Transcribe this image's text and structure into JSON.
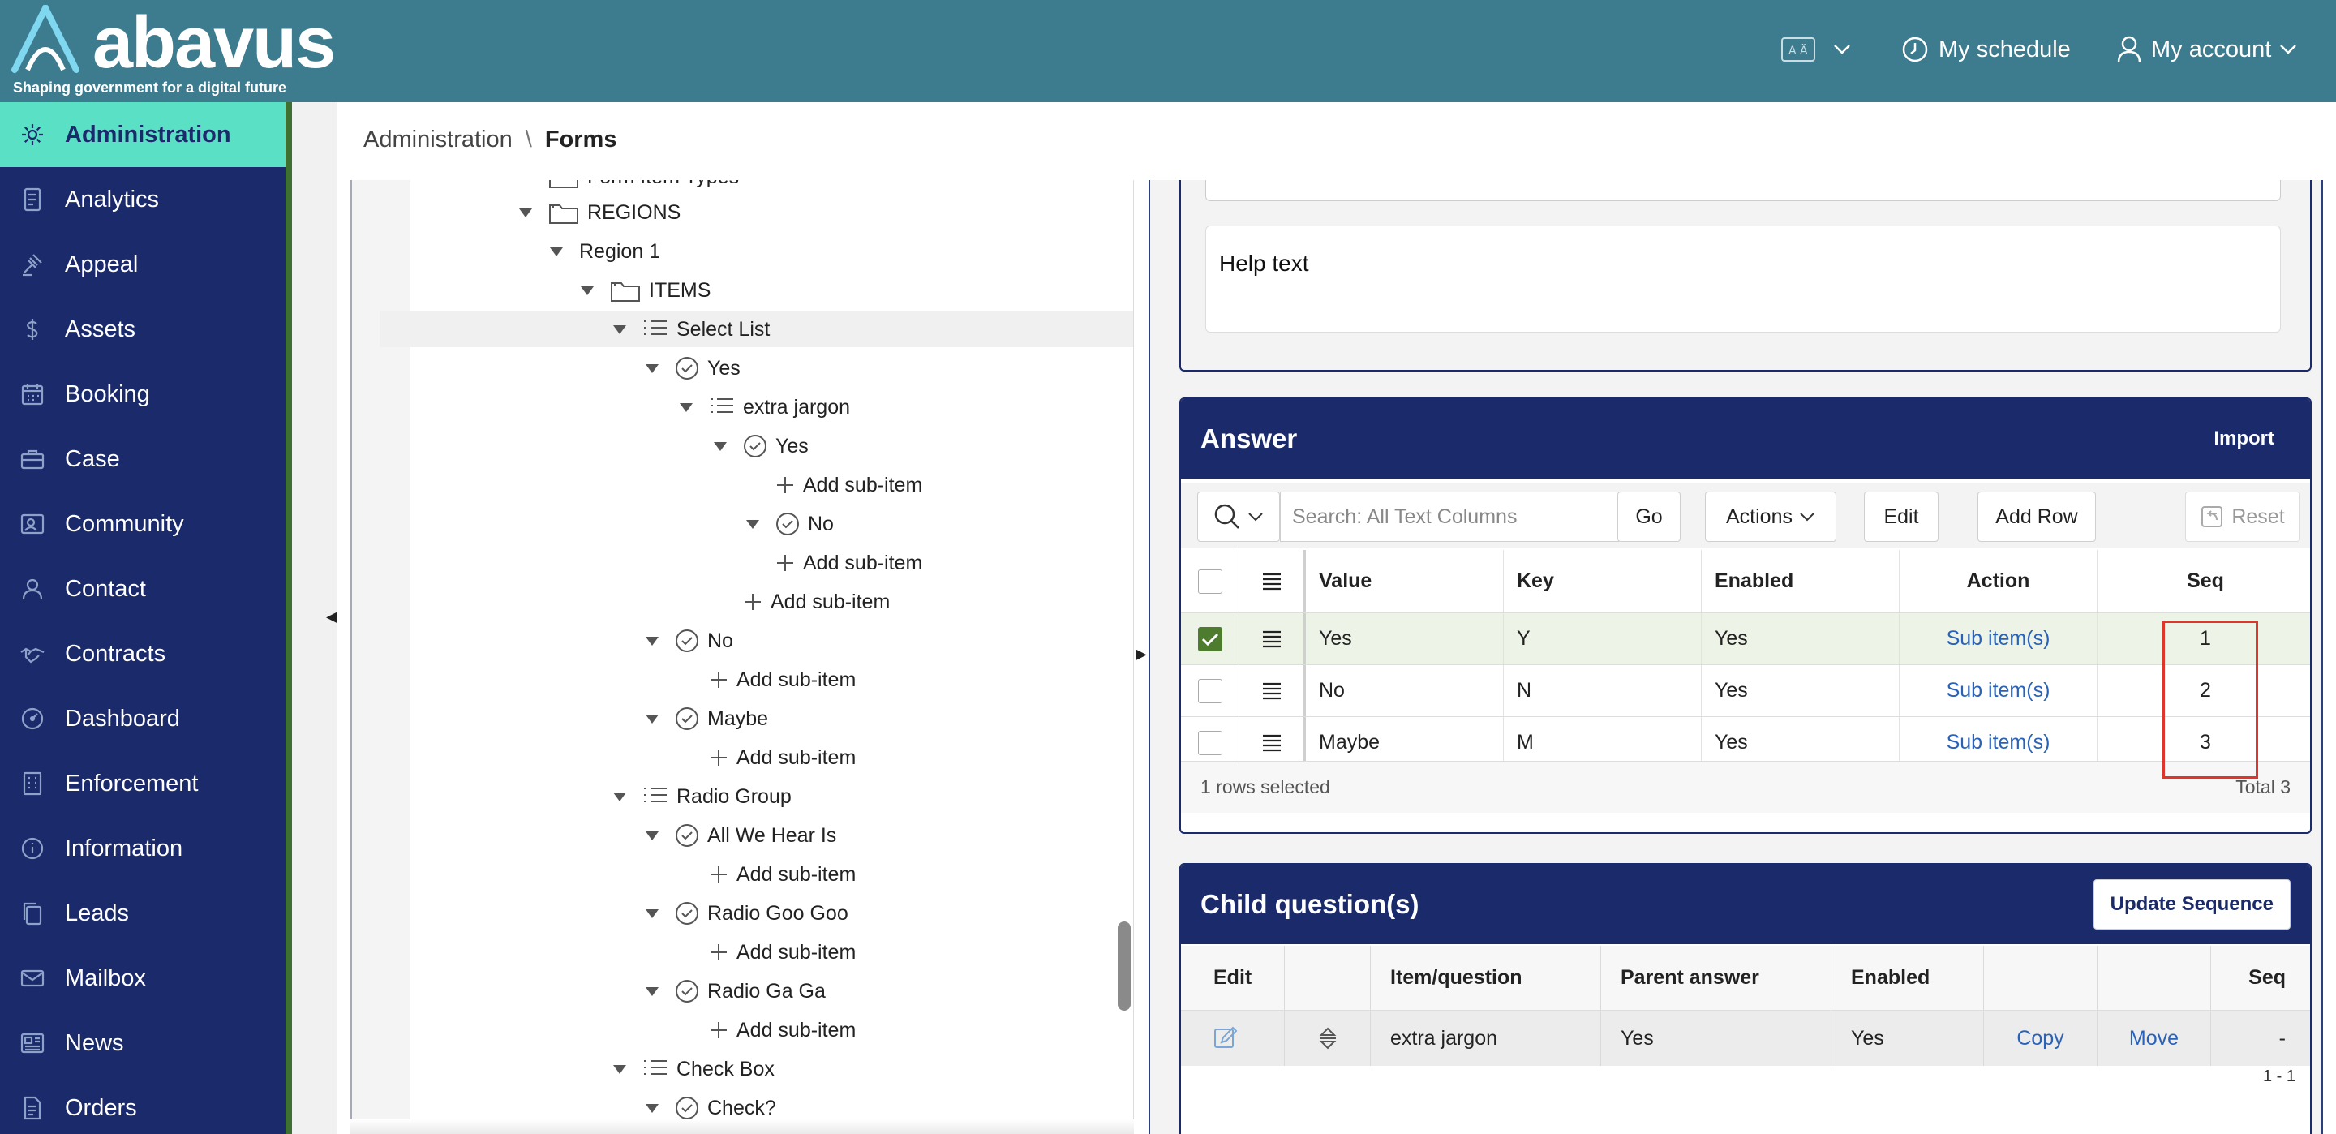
{
  "brand": {
    "name": "abavus",
    "tagline": "Shaping government for a digital future"
  },
  "topbar": {
    "schedule_label": "My schedule",
    "account_label": "My account"
  },
  "sidebar": {
    "items": [
      {
        "label": "Administration",
        "icon": "gear-icon",
        "active": true
      },
      {
        "label": "Analytics",
        "icon": "document-icon"
      },
      {
        "label": "Appeal",
        "icon": "gavel-icon"
      },
      {
        "label": "Assets",
        "icon": "dollar-icon"
      },
      {
        "label": "Booking",
        "icon": "calendar-icon"
      },
      {
        "label": "Case",
        "icon": "briefcase-icon"
      },
      {
        "label": "Community",
        "icon": "person-card-icon"
      },
      {
        "label": "Contact",
        "icon": "person-icon"
      },
      {
        "label": "Contracts",
        "icon": "handshake-icon"
      },
      {
        "label": "Dashboard",
        "icon": "gauge-icon"
      },
      {
        "label": "Enforcement",
        "icon": "building-icon"
      },
      {
        "label": "Information",
        "icon": "info-icon"
      },
      {
        "label": "Leads",
        "icon": "copy-icon"
      },
      {
        "label": "Mailbox",
        "icon": "mail-icon"
      },
      {
        "label": "News",
        "icon": "newspaper-icon"
      },
      {
        "label": "Orders",
        "icon": "file-icon"
      }
    ]
  },
  "breadcrumb": {
    "parent": "Administration",
    "separator": "\\",
    "current": "Forms"
  },
  "tree": {
    "partial_label": "Form Item Types",
    "nodes": [
      {
        "label": "REGIONS",
        "icon": "folder-icon",
        "tri": true
      },
      {
        "label": "Region 1",
        "icon": "",
        "tri": true
      },
      {
        "label": "ITEMS",
        "icon": "folder-icon",
        "tri": true
      },
      {
        "label": "Select List",
        "icon": "list-icon",
        "tri": true,
        "selected": true
      },
      {
        "label": "Yes",
        "icon": "check-circle-icon",
        "tri": true
      },
      {
        "label": "extra jargon",
        "icon": "list-icon",
        "tri": true
      },
      {
        "label": "Yes",
        "icon": "check-circle-icon",
        "tri": true
      },
      {
        "label": "Add sub-item",
        "icon": "plus-icon",
        "tri": false
      },
      {
        "label": "No",
        "icon": "check-circle-icon",
        "tri": true
      },
      {
        "label": "Add sub-item",
        "icon": "plus-icon",
        "tri": false
      },
      {
        "label": "Add sub-item",
        "icon": "plus-icon",
        "tri": false
      },
      {
        "label": "No",
        "icon": "check-circle-icon",
        "tri": true
      },
      {
        "label": "Add sub-item",
        "icon": "plus-icon",
        "tri": false
      },
      {
        "label": "Maybe",
        "icon": "check-circle-icon",
        "tri": true
      },
      {
        "label": "Add sub-item",
        "icon": "plus-icon",
        "tri": false
      },
      {
        "label": "Radio Group",
        "icon": "list-icon",
        "tri": true
      },
      {
        "label": "All We Hear Is",
        "icon": "check-circle-icon",
        "tri": true
      },
      {
        "label": "Add sub-item",
        "icon": "plus-icon",
        "tri": false
      },
      {
        "label": "Radio Goo Goo",
        "icon": "check-circle-icon",
        "tri": true
      },
      {
        "label": "Add sub-item",
        "icon": "plus-icon",
        "tri": false
      },
      {
        "label": "Radio Ga Ga",
        "icon": "check-circle-icon",
        "tri": true
      },
      {
        "label": "Add sub-item",
        "icon": "plus-icon",
        "tri": false
      },
      {
        "label": "Check Box",
        "icon": "list-icon",
        "tri": true
      },
      {
        "label": "Check?",
        "icon": "check-circle-icon",
        "tri": true
      }
    ]
  },
  "help": {
    "text": "Help text"
  },
  "answer": {
    "title": "Answer",
    "import_label": "Import",
    "search_placeholder": "Search: All Text Columns",
    "go_label": "Go",
    "actions_label": "Actions",
    "edit_label": "Edit",
    "add_row_label": "Add Row",
    "reset_label": "Reset",
    "columns": [
      "Value",
      "Key",
      "Enabled",
      "Action",
      "Seq"
    ],
    "rows": [
      {
        "value": "Yes",
        "key": "Y",
        "enabled": "Yes",
        "action": "Sub item(s)",
        "seq": "1",
        "selected": true
      },
      {
        "value": "No",
        "key": "N",
        "enabled": "Yes",
        "action": "Sub item(s)",
        "seq": "2",
        "selected": false
      },
      {
        "value": "Maybe",
        "key": "M",
        "enabled": "Yes",
        "action": "Sub item(s)",
        "seq": "3",
        "selected": false
      }
    ],
    "selected_text": "1 rows selected",
    "total_text": "Total 3"
  },
  "child": {
    "title": "Child question(s)",
    "update_label": "Update Sequence",
    "columns": {
      "edit": "Edit",
      "item": "Item/question",
      "parent": "Parent answer",
      "enabled": "Enabled",
      "seq": "Seq"
    },
    "row": {
      "item": "extra jargon",
      "parent": "Yes",
      "enabled": "Yes",
      "copy": "Copy",
      "move": "Move",
      "seq": "-"
    },
    "pagination": "1 - 1"
  },
  "colors": {
    "topbar": "#3d7b8e",
    "sidebar": "#1b2a6b",
    "active": "#5ae0c4",
    "highlight": "#e0352b"
  }
}
